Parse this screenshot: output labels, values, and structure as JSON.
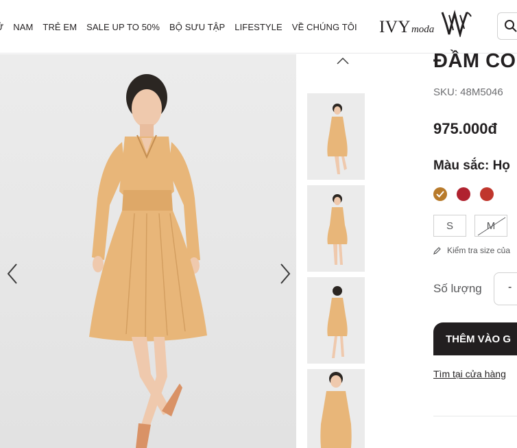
{
  "header": {
    "nav_cut": "Ữ",
    "nav_items": [
      "NAM",
      "TRẺ EM",
      "SALE UP TO 50%",
      "BỘ SƯU TẬP",
      "LIFESTYLE",
      "VỀ CHÚNG TÔI"
    ],
    "logo_ivy": "IVY",
    "logo_moda": "moda"
  },
  "product": {
    "title": "ĐẦM CO",
    "sku": "SKU: 48M5046",
    "price": "975.000đ",
    "color_label": "Màu sắc: Họ",
    "colors": [
      "#b87a2a",
      "#b0222f",
      "#c0362c"
    ],
    "sizes": [
      "S",
      "M"
    ],
    "size_check": "Kiểm tra size của",
    "qty_label": "Số lượng",
    "qty_minus": "-",
    "add_to_cart": "THÊM VÀO G",
    "find_store": "Tìm tại cửa hàng"
  },
  "colors": {
    "text": "#221f20",
    "muted": "#6c6d70",
    "dress": "#e8b679"
  }
}
